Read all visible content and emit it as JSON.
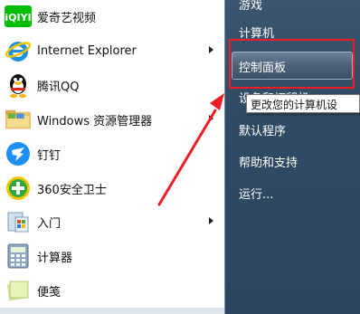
{
  "programs": [
    {
      "label": "爱奇艺视频",
      "icon": "iqiyi-icon",
      "has_arrow": false
    },
    {
      "label": "Internet Explorer",
      "icon": "internet-explorer-icon",
      "has_arrow": true
    },
    {
      "label": "腾讯QQ",
      "icon": "qq-penguin-icon",
      "has_arrow": false
    },
    {
      "label": "Windows 资源管理器",
      "icon": "folder-explorer-icon",
      "has_arrow": true
    },
    {
      "label": "钉钉",
      "icon": "dingtalk-icon",
      "has_arrow": false
    },
    {
      "label": "360安全卫士",
      "icon": "360-security-icon",
      "has_arrow": false
    },
    {
      "label": "入门",
      "icon": "getting-started-icon",
      "has_arrow": true
    },
    {
      "label": "计算器",
      "icon": "calculator-icon",
      "has_arrow": false
    },
    {
      "label": "便笺",
      "icon": "sticky-notes-icon",
      "has_arrow": false
    }
  ],
  "iqiyi_logo_text": "iQIYI",
  "right_menu": {
    "games": "游戏",
    "computer": "计算机",
    "control_panel": "控制面板",
    "devices_printers": "设备和打印机",
    "default_programs": "默认程序",
    "help_support": "帮助和支持",
    "run": "运行..."
  },
  "tooltip": "更改您的计算机设",
  "colors": {
    "right_panel": "#2f4a63",
    "highlight_box": "#ee1c24",
    "arrow": "#ee1c24"
  }
}
